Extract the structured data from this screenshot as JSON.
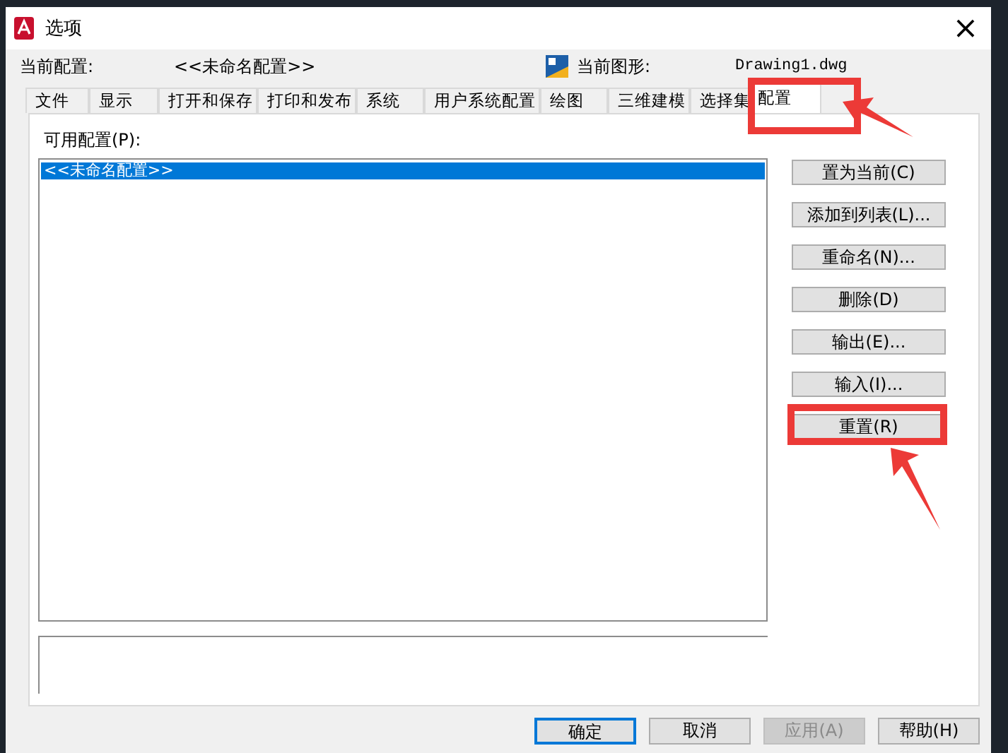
{
  "window": {
    "title": "选项",
    "close": "×"
  },
  "info": {
    "current_profile_label": "当前配置:",
    "current_profile": "<<未命名配置>>",
    "current_drawing_label": "当前图形:",
    "current_drawing": "Drawing1.dwg"
  },
  "tabs": [
    {
      "label": "文件",
      "selected": false,
      "highlighted": false
    },
    {
      "label": "显示",
      "selected": false,
      "highlighted": false
    },
    {
      "label": "打开和保存",
      "selected": false,
      "highlighted": false
    },
    {
      "label": "打印和发布",
      "selected": false,
      "highlighted": false
    },
    {
      "label": "系统",
      "selected": false,
      "highlighted": false
    },
    {
      "label": "用户系统配置",
      "selected": false,
      "highlighted": false
    },
    {
      "label": "绘图",
      "selected": false,
      "highlighted": false
    },
    {
      "label": "三维建模",
      "selected": false,
      "highlighted": false
    },
    {
      "label": "选择集",
      "selected": false,
      "highlighted": false
    },
    {
      "label": "配置",
      "selected": true,
      "highlighted": true
    }
  ],
  "profiles": {
    "label": "可用配置(P):",
    "items": [
      {
        "name": "<<未命名配置>>",
        "selected": true
      }
    ]
  },
  "side_buttons": [
    {
      "label": "置为当前(C)",
      "highlighted": false
    },
    {
      "label": "添加到列表(L)...",
      "highlighted": false
    },
    {
      "label": "重命名(N)...",
      "highlighted": false
    },
    {
      "label": "删除(D)",
      "highlighted": false
    },
    {
      "label": "输出(E)...",
      "highlighted": false
    },
    {
      "label": "输入(I)...",
      "highlighted": false
    },
    {
      "label": "重置(R)",
      "highlighted": true
    }
  ],
  "footer_buttons": [
    {
      "label": "确定",
      "default": true,
      "disabled": false
    },
    {
      "label": "取消",
      "default": false,
      "disabled": false
    },
    {
      "label": "应用(A)",
      "default": false,
      "disabled": true
    },
    {
      "label": "帮助(H)",
      "default": false,
      "disabled": false
    }
  ]
}
